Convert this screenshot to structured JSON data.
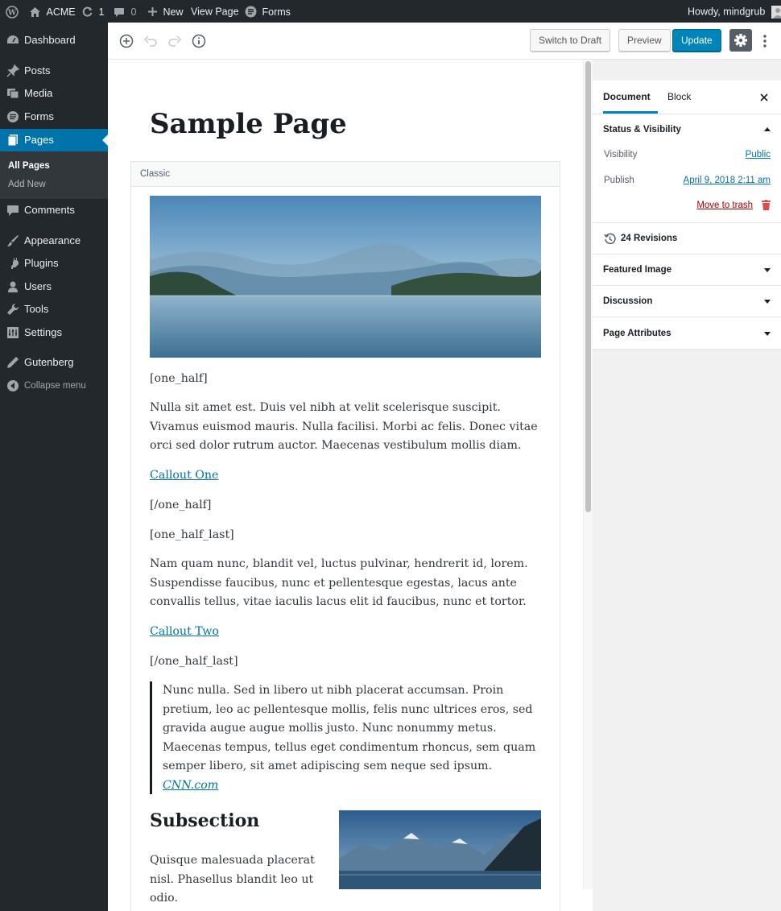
{
  "admin_bar": {
    "site_name": "ACME",
    "updates_count": "1",
    "comments_count": "0",
    "new_label": "New",
    "view_page_label": "View Page",
    "forms_label": "Forms",
    "greeting": "Howdy, mindgrub"
  },
  "sidebar": {
    "items": [
      {
        "label": "Dashboard",
        "icon": "dashboard-icon"
      },
      {
        "label": "Posts",
        "icon": "pin-icon"
      },
      {
        "label": "Media",
        "icon": "media-icon"
      },
      {
        "label": "Forms",
        "icon": "forms-icon"
      },
      {
        "label": "Pages",
        "icon": "pages-icon"
      },
      {
        "label": "Comments",
        "icon": "comment-icon"
      },
      {
        "label": "Appearance",
        "icon": "brush-icon"
      },
      {
        "label": "Plugins",
        "icon": "plugin-icon"
      },
      {
        "label": "Users",
        "icon": "user-icon"
      },
      {
        "label": "Tools",
        "icon": "wrench-icon"
      },
      {
        "label": "Settings",
        "icon": "settings-icon"
      },
      {
        "label": "Gutenberg",
        "icon": "pencil-icon"
      },
      {
        "label": "Collapse menu",
        "icon": "collapse-icon"
      }
    ],
    "submenu": [
      "All Pages",
      "Add New"
    ]
  },
  "toolbar": {
    "switch_to_draft_label": "Switch to Draft",
    "preview_label": "Preview",
    "update_label": "Update"
  },
  "content": {
    "title": "Sample Page",
    "block_label": "Classic",
    "p1": "[one_half]",
    "p2": "Nulla sit amet est. Duis vel nibh at velit scelerisque suscipit. Vivamus euismod mauris. Nulla facilisi. Morbi ac felis. Donec vitae orci sed dolor rutrum auctor. Maecenas vestibulum mollis diam.",
    "link1": "Callout One",
    "p3": "[/one_half]",
    "p4": "[one_half_last]",
    "p5": "Nam quam nunc, blandit vel, luctus pulvinar, hendrerit id, lorem. Suspendisse faucibus, nunc et pellentesque egestas, lacus ante convallis tellus, vitae iaculis lacus elit id faucibus, nunc et tortor.",
    "link2": "Callout Two",
    "p6": "[/one_half_last]",
    "quote": "Nunc nulla. Sed in libero ut nibh placerat accumsan. Proin pretium, leo ac pellentesque mollis, felis nunc ultrices eros, sed gravida augue augue mollis justo. Nunc nonummy metus. Maecenas tempus, tellus eget condimentum rhoncus, sem quam semper libero, sit amet adipiscing sem neque sed ipsum.",
    "cite": "CNN.com",
    "subheading": "Subsection",
    "p7": "Quisque malesuada placerat nisl. Phasellus blandit leo ut odio."
  },
  "settings_sidebar": {
    "tabs": [
      "Document",
      "Block"
    ],
    "status_title": "Status & Visibility",
    "visibility_label": "Visibility",
    "visibility_value": "Public",
    "publish_label": "Publish",
    "publish_value": "April 9, 2018 2:11 am",
    "trash_label": "Move to trash",
    "revisions_label": "24 Revisions",
    "featured_image_title": "Featured Image",
    "discussion_title": "Discussion",
    "page_attributes_title": "Page Attributes"
  },
  "colors": {
    "admin_dark": "#23282d",
    "accent": "#0073aa",
    "primary_button": "#0085ba",
    "danger": "#a00"
  }
}
